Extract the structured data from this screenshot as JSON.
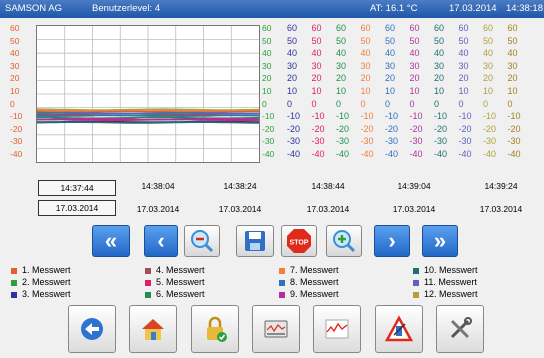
{
  "header": {
    "company": "SAMSON AG",
    "user_level": "Benutzerlevel:  4",
    "ambient_temp": "AT: 16.1 °C",
    "date": "17.03.2014",
    "time": "14:38:18"
  },
  "chart": {
    "left_scale": [
      "60",
      "50",
      "40",
      "30",
      "20",
      "10",
      "0",
      "-10",
      "-20",
      "-30",
      "-40"
    ],
    "right_scale": [
      "60",
      "50",
      "40",
      "30",
      "20",
      "10",
      "0",
      "-10",
      "-20",
      "-30",
      "-40"
    ],
    "grid_cols": 8,
    "grid_rows": 10,
    "range": [
      -40,
      60
    ],
    "series_colors": [
      "#e06030",
      "#2aa040",
      "#3030a0",
      "#a05050",
      "#e02060",
      "#209050",
      "#f08040",
      "#3070c0",
      "#b030a0",
      "#207070",
      "#6060c0",
      "#b0a040"
    ]
  },
  "value_table": {
    "columns": [
      [
        "60",
        "50",
        "40",
        "30",
        "20",
        "10",
        "0",
        "-10",
        "-20",
        "-30",
        "-40"
      ],
      [
        "60",
        "50",
        "40",
        "30",
        "20",
        "10",
        "0",
        "-10",
        "-20",
        "-30",
        "-40"
      ],
      [
        "60",
        "50",
        "40",
        "30",
        "20",
        "10",
        "0",
        "-10",
        "-20",
        "-30",
        "-40"
      ],
      [
        "60",
        "50",
        "40",
        "30",
        "20",
        "10",
        "0",
        "-10",
        "-20",
        "-30",
        "-40"
      ],
      [
        "60",
        "50",
        "40",
        "30",
        "20",
        "10",
        "0",
        "-10",
        "-20",
        "-30",
        "-40"
      ],
      [
        "60",
        "50",
        "40",
        "30",
        "20",
        "10",
        "0",
        "-10",
        "-20",
        "-30",
        "-40"
      ],
      [
        "60",
        "50",
        "40",
        "30",
        "20",
        "10",
        "0",
        "-10",
        "-20",
        "-30",
        "-40"
      ],
      [
        "60",
        "50",
        "40",
        "30",
        "20",
        "10",
        "0",
        "-10",
        "-20",
        "-30",
        "-40"
      ],
      [
        "60",
        "50",
        "40",
        "30",
        "20",
        "10",
        "0",
        "-10",
        "-20",
        "-30",
        "-40"
      ],
      [
        "60",
        "50",
        "40",
        "30",
        "20",
        "10",
        "0",
        "-10",
        "-20",
        "-30",
        "-40"
      ]
    ],
    "column_colors": [
      "#3030a0",
      "#e02060",
      "#209050",
      "#f08040",
      "#3070c0",
      "#b030a0",
      "#207070",
      "#6060c0",
      "#b0a040",
      "#a08020"
    ]
  },
  "time_axis": {
    "start_time": "14:37:44",
    "start_date": "17.03.2014",
    "times": [
      "14:38:04",
      "14:38:24",
      "14:38:44",
      "14:39:04",
      "14:39:24"
    ],
    "dates": [
      "17.03.2014",
      "17.03.2014",
      "17.03.2014",
      "17.03.2014",
      "17.03.2014"
    ]
  },
  "nav": [
    {
      "name": "jump-back",
      "glyph": "«",
      "style": "blue"
    },
    {
      "name": "step-back",
      "glyph": "‹",
      "style": "blue"
    },
    {
      "name": "zoom-out",
      "glyph": "−",
      "style": "white"
    },
    {
      "name": "save",
      "glyph": "",
      "style": "white"
    },
    {
      "name": "stop",
      "glyph": "STOP",
      "style": "white"
    },
    {
      "name": "zoom-in",
      "glyph": "+",
      "style": "white"
    },
    {
      "name": "step-forward",
      "glyph": "›",
      "style": "blue"
    },
    {
      "name": "jump-forward",
      "glyph": "»",
      "style": "blue"
    }
  ],
  "legend": [
    {
      "label": "1. Messwert",
      "color": "#e06030"
    },
    {
      "label": "2. Messwert",
      "color": "#2aa040"
    },
    {
      "label": "3. Messwert",
      "color": "#3030a0"
    },
    {
      "label": "4. Messwert",
      "color": "#a05050"
    },
    {
      "label": "5. Messwert",
      "color": "#e02060"
    },
    {
      "label": "6. Messwert",
      "color": "#209050"
    },
    {
      "label": "7. Messwert",
      "color": "#f08040"
    },
    {
      "label": "8. Messwert",
      "color": "#3070c0"
    },
    {
      "label": "9. Messwert",
      "color": "#b030a0"
    },
    {
      "label": "10. Messwert",
      "color": "#207070"
    },
    {
      "label": "11. Messwert",
      "color": "#6060c0"
    },
    {
      "label": "12. Messwert",
      "color": "#b0a040"
    }
  ],
  "toolbar": [
    {
      "name": "back",
      "icon": "back-arrow-icon"
    },
    {
      "name": "home",
      "icon": "home-icon"
    },
    {
      "name": "lock",
      "icon": "lock-icon"
    },
    {
      "name": "recorder",
      "icon": "recorder-icon"
    },
    {
      "name": "trend",
      "icon": "trend-icon"
    },
    {
      "name": "alarm",
      "icon": "warning-icon"
    },
    {
      "name": "settings",
      "icon": "tools-icon"
    }
  ]
}
